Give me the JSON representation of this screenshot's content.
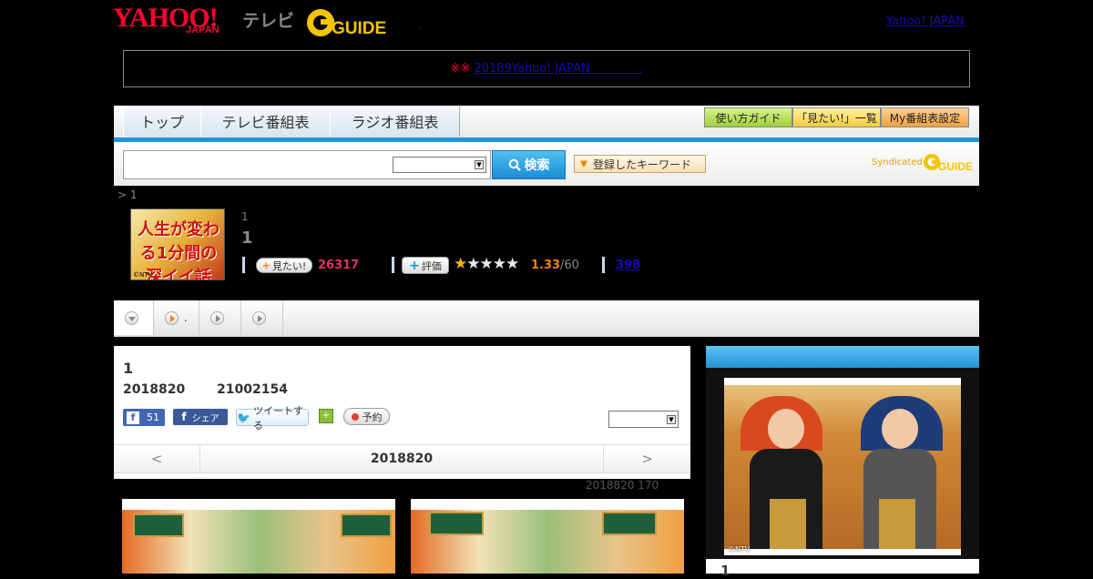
{
  "header": {
    "logo_yahoo": "YAHOO!",
    "logo_japan": "JAPAN",
    "logo_tv": "テレビ",
    "logo_gguide": "G GUIDE",
    "link_yahoo_japan": "Yahoo! JAPAN",
    "dot": ".",
    "dot_left": "."
  },
  "notice": {
    "mark": "※※",
    "link_text": "20189Yahoo! JAPAN"
  },
  "nav": {
    "tabs": [
      "トップ",
      "テレビ番組表",
      "ラジオ番組表"
    ],
    "buttons": [
      "使い方ガイド",
      "「見たい!」一覧",
      "My番組表設定"
    ]
  },
  "search": {
    "placeholder": "",
    "button_label": "検索",
    "keyword_button": "登録したキーワード",
    "syndicated": "Syndicated",
    "gguide": "G GUIDE"
  },
  "breadcrumb": "> 1",
  "program": {
    "thumb_text": "人生が変わる1分間の深イイ話",
    "thumb_copyright": "©NTV",
    "small_label": "1",
    "title": "1",
    "want_label": "見たい!",
    "want_count": "26317",
    "rate_label": "評価",
    "rating_fraction": 0.27,
    "rating": "1.33",
    "rating_max": "/60",
    "review_count": "398"
  },
  "tabstrip": {
    "item2_text": "."
  },
  "episode": {
    "number": "1",
    "date": "2018820",
    "time": "21002154",
    "fb_count": "51",
    "fb_share": "シェア",
    "tweet": "ツイートする",
    "reserve": "予約",
    "nav_prev": "<",
    "nav_current": "2018820",
    "nav_next": ">",
    "meta": "2018820  170"
  },
  "side": {
    "copyright": "©NTV",
    "bottom_text": "1"
  },
  "colors": {
    "accent_blue": "#1d98d6",
    "want_pink": "#e0306a",
    "rating_orange": "#f08000",
    "yahoo_red": "#ff0033"
  }
}
